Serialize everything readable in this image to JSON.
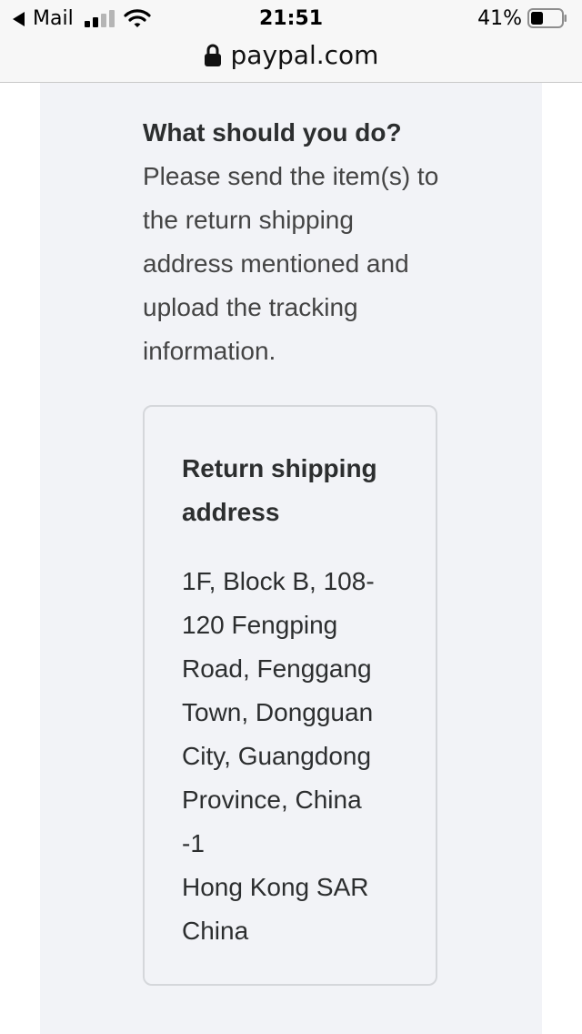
{
  "status_bar": {
    "back_app": "Mail",
    "time": "21:51",
    "battery_percent": "41%",
    "battery_level": 0.41,
    "signal_bars": 2
  },
  "browser": {
    "url": "paypal.com"
  },
  "content": {
    "question": "What should you do?",
    "instructions": "Please send the item(s) to the return shipping address mentioned and upload the tracking information.",
    "address_card": {
      "title": "Return shipping address",
      "lines": [
        "1F, Block B, 108-120 Fengping Road, Fenggang Town, Dongguan City, Guangdong Province, China",
        "-1",
        "Hong Kong SAR China"
      ]
    }
  },
  "colors": {
    "panel_background": "#f2f3f7",
    "card_border": "#d5d7db",
    "text_primary": "#2c2e2f",
    "chrome_background": "#f7f7f7"
  }
}
